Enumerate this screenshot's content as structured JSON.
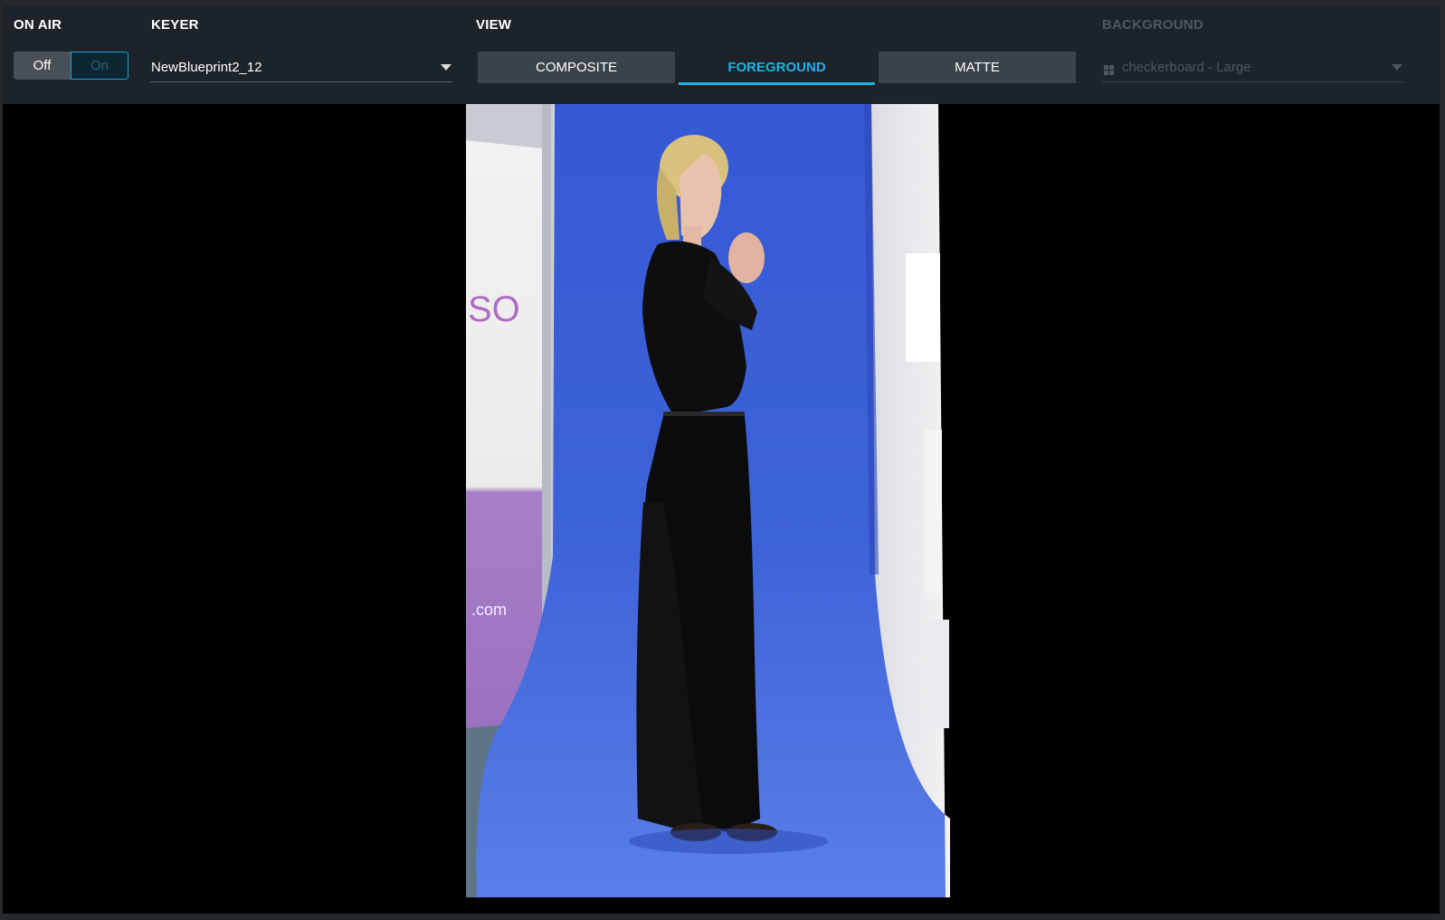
{
  "on_air": {
    "label": "ON AIR",
    "off_label": "Off",
    "on_label": "On",
    "state": "Off"
  },
  "keyer": {
    "label": "KEYER",
    "selected": "NewBlueprint2_12"
  },
  "view": {
    "label": "VIEW",
    "tabs": [
      {
        "label": "COMPOSITE",
        "active": false
      },
      {
        "label": "FOREGROUND",
        "active": true
      },
      {
        "label": "MATTE",
        "active": false
      }
    ]
  },
  "background": {
    "label": "BACKGROUND",
    "selected": "checkerboard - Large",
    "icon": "checkerboard-grid-icon",
    "enabled": false
  },
  "colors": {
    "accent": "#1cb2ec",
    "toolbar_bg": "#1c2329",
    "tab_bg": "#3a4349",
    "screen_blue": "#3d63d8"
  }
}
